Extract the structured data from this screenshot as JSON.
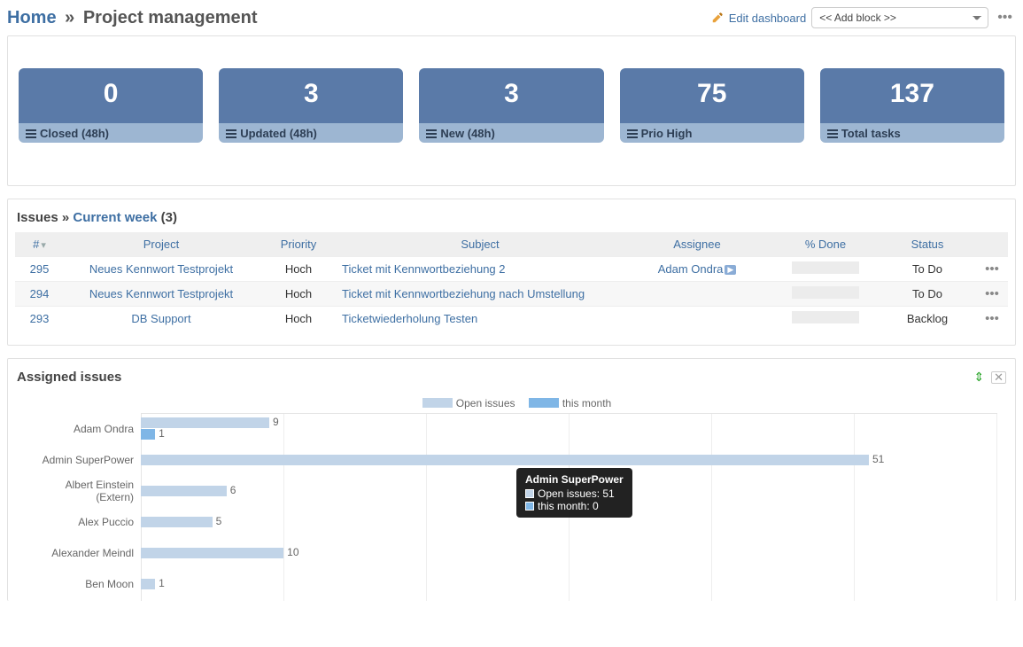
{
  "header": {
    "home": "Home",
    "sep": "»",
    "title": "Project management",
    "edit_dashboard": "Edit dashboard",
    "add_block_placeholder": "<< Add block >>"
  },
  "kpis": [
    {
      "value": "0",
      "label": "Closed (48h)"
    },
    {
      "value": "3",
      "label": "Updated (48h)"
    },
    {
      "value": "3",
      "label": "New (48h)"
    },
    {
      "value": "75",
      "label": "Prio High"
    },
    {
      "value": "137",
      "label": "Total tasks"
    }
  ],
  "issues_panel": {
    "title_prefix": "Issues",
    "title_sep": "»",
    "title_link": "Current week",
    "title_count": "(3)",
    "columns": {
      "id": "#",
      "project": "Project",
      "priority": "Priority",
      "subject": "Subject",
      "assignee": "Assignee",
      "done": "% Done",
      "status": "Status"
    },
    "rows": [
      {
        "id": "295",
        "project": "Neues Kennwort Testprojekt",
        "priority": "Hoch",
        "subject": "Ticket mit Kennwortbeziehung 2",
        "assignee": "Adam Ondra",
        "assignee_badge": true,
        "status": "To Do"
      },
      {
        "id": "294",
        "project": "Neues Kennwort Testprojekt",
        "priority": "Hoch",
        "subject": "Ticket mit Kennwortbeziehung nach Umstellung",
        "assignee": "",
        "assignee_badge": false,
        "status": "To Do"
      },
      {
        "id": "293",
        "project": "DB Support",
        "priority": "Hoch",
        "subject": "Ticketwiederholung Testen",
        "assignee": "",
        "assignee_badge": false,
        "status": "Backlog"
      }
    ]
  },
  "chart_data": {
    "type": "bar",
    "title": "Assigned issues",
    "legend": {
      "open": "Open issues",
      "month": "this month"
    },
    "categories": [
      "Adam Ondra",
      "Admin SuperPower",
      "Albert Einstein (Extern)",
      "Alex Puccio",
      "Alexander Meindl",
      "Ben Moon"
    ],
    "series": [
      {
        "name": "Open issues",
        "values": [
          9,
          51,
          6,
          5,
          10,
          1
        ]
      },
      {
        "name": "this month",
        "values": [
          1,
          0,
          0,
          0,
          0,
          0
        ]
      }
    ],
    "xlim": [
      0,
      60
    ],
    "tooltip": {
      "name": "Admin SuperPower",
      "open_label": "Open issues: 51",
      "month_label": "this month: 0"
    }
  }
}
